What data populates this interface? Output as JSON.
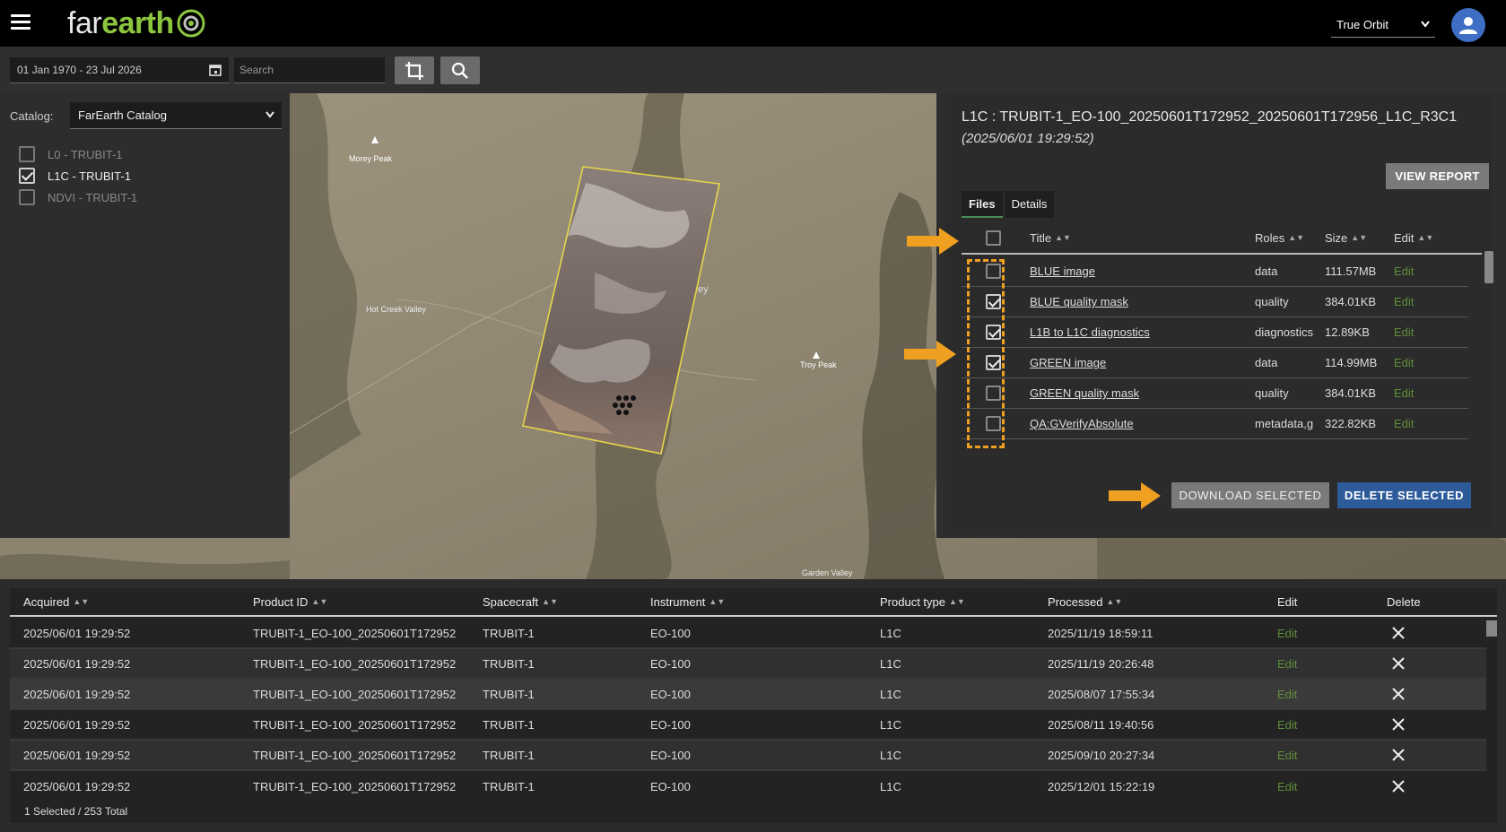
{
  "app": {
    "logo_part1": "far",
    "logo_part2": "earth",
    "view_mode": "True Orbit"
  },
  "toolbar": {
    "date_range": "01 Jan 1970 - 23 Jul 2026",
    "search_placeholder": "Search"
  },
  "catalog": {
    "label": "Catalog:",
    "selected": "FarEarth Catalog",
    "items": [
      {
        "label": "L0 - TRUBIT-1",
        "checked": false
      },
      {
        "label": "L1C - TRUBIT-1",
        "checked": true
      },
      {
        "label": "NDVI - TRUBIT-1",
        "checked": false
      }
    ]
  },
  "map": {
    "labels": [
      "Morey Peak",
      "Hot Creek Valley",
      "Troy Peak",
      "Garden Valley",
      "ey"
    ]
  },
  "details": {
    "title": "L1C : TRUBIT-1_EO-100_20250601T172952_20250601T172956_L1C_R3C1",
    "timestamp": "(2025/06/01 19:29:52)",
    "view_report": "VIEW REPORT",
    "tabs": [
      "Files",
      "Details"
    ],
    "columns": {
      "title": "Title",
      "roles": "Roles",
      "size": "Size",
      "edit": "Edit"
    },
    "files": [
      {
        "title": "BLUE image",
        "role": "data",
        "size": "111.57MB",
        "edit": "Edit",
        "checked": false
      },
      {
        "title": "BLUE quality mask",
        "role": "quality",
        "size": "384.01KB",
        "edit": "Edit",
        "checked": true
      },
      {
        "title": "L1B to L1C diagnostics",
        "role": "diagnostics",
        "size": "12.89KB",
        "edit": "Edit",
        "checked": true
      },
      {
        "title": "GREEN image",
        "role": "data",
        "size": "114.99MB",
        "edit": "Edit",
        "checked": true
      },
      {
        "title": "GREEN quality mask",
        "role": "quality",
        "size": "384.01KB",
        "edit": "Edit",
        "checked": false
      },
      {
        "title": "QA:GVerifyAbsolute",
        "role": "metadata,g",
        "size": "322.82KB",
        "edit": "Edit",
        "checked": false
      }
    ],
    "download_selected": "DOWNLOAD SELECTED",
    "delete_selected": "DELETE SELECTED"
  },
  "results": {
    "columns": {
      "acquired": "Acquired",
      "product_id": "Product ID",
      "spacecraft": "Spacecraft",
      "instrument": "Instrument",
      "product_type": "Product type",
      "processed": "Processed",
      "edit": "Edit",
      "delete": "Delete"
    },
    "rows": [
      {
        "acquired": "2025/06/01 19:29:52",
        "product_id": "TRUBIT-1_EO-100_20250601T172952",
        "spacecraft": "TRUBIT-1",
        "instrument": "EO-100",
        "product_type": "L1C",
        "processed": "2025/11/19 18:59:11",
        "edit": "Edit"
      },
      {
        "acquired": "2025/06/01 19:29:52",
        "product_id": "TRUBIT-1_EO-100_20250601T172952",
        "spacecraft": "TRUBIT-1",
        "instrument": "EO-100",
        "product_type": "L1C",
        "processed": "2025/11/19 20:26:48",
        "edit": "Edit"
      },
      {
        "acquired": "2025/06/01 19:29:52",
        "product_id": "TRUBIT-1_EO-100_20250601T172952",
        "spacecraft": "TRUBIT-1",
        "instrument": "EO-100",
        "product_type": "L1C",
        "processed": "2025/08/07 17:55:34",
        "edit": "Edit"
      },
      {
        "acquired": "2025/06/01 19:29:52",
        "product_id": "TRUBIT-1_EO-100_20250601T172952",
        "spacecraft": "TRUBIT-1",
        "instrument": "EO-100",
        "product_type": "L1C",
        "processed": "2025/08/11 19:40:56",
        "edit": "Edit"
      },
      {
        "acquired": "2025/06/01 19:29:52",
        "product_id": "TRUBIT-1_EO-100_20250601T172952",
        "spacecraft": "TRUBIT-1",
        "instrument": "EO-100",
        "product_type": "L1C",
        "processed": "2025/09/10 20:27:34",
        "edit": "Edit"
      },
      {
        "acquired": "2025/06/01 19:29:52",
        "product_id": "TRUBIT-1_EO-100_20250601T172952",
        "spacecraft": "TRUBIT-1",
        "instrument": "EO-100",
        "product_type": "L1C",
        "processed": "2025/12/01 15:22:19",
        "edit": "Edit"
      }
    ],
    "footer": "1 Selected / 253 Total"
  },
  "colors": {
    "accent_green": "#8cc63f",
    "edit_green": "#5f8f3a",
    "delete_blue": "#2d5b9a",
    "annotation_orange": "#f0a020"
  },
  "icons": [
    "menu-icon",
    "chevron-down-icon",
    "user-icon",
    "calendar-icon",
    "crop-icon",
    "search-icon",
    "close-icon",
    "sort-icon",
    "peak-icon"
  ]
}
